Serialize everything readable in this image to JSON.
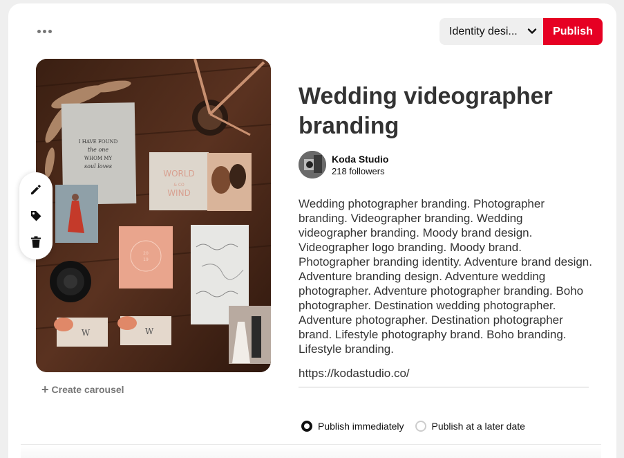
{
  "toolbar": {
    "board_selected": "Identity desi...",
    "publish_label": "Publish"
  },
  "pin": {
    "title": "Wedding videographer branding",
    "author": {
      "name": "Koda Studio",
      "followers": "218 followers"
    },
    "description": "Wedding photographer branding. Photographer branding. Videographer branding. Wedding videographer branding. Moody brand design. Videographer logo branding.  Moody brand. Photographer branding identity. Adventure brand design. Adventure branding design. Adventure wedding photographer. Adventure photographer branding. Boho photographer. Destination wedding photographer. Adventure photographer. Destination photographer brand. Lifestyle photography brand. Boho branding. Lifestyle branding.",
    "link": "https://kodastudio.co/"
  },
  "image": {
    "card1_text": "I HAVE FOUND the one WHOM MY soul loves",
    "card2_line1": "WORLD",
    "card2_line2": "& CO",
    "card2_line3": "WIND",
    "card3_text": "20 19"
  },
  "carousel_label": "Create carousel",
  "schedule": {
    "options": [
      "Publish immediately",
      "Publish at a later date"
    ],
    "selected": 0
  },
  "colors": {
    "publish_red": "#e60023",
    "select_bg": "#efefef"
  }
}
